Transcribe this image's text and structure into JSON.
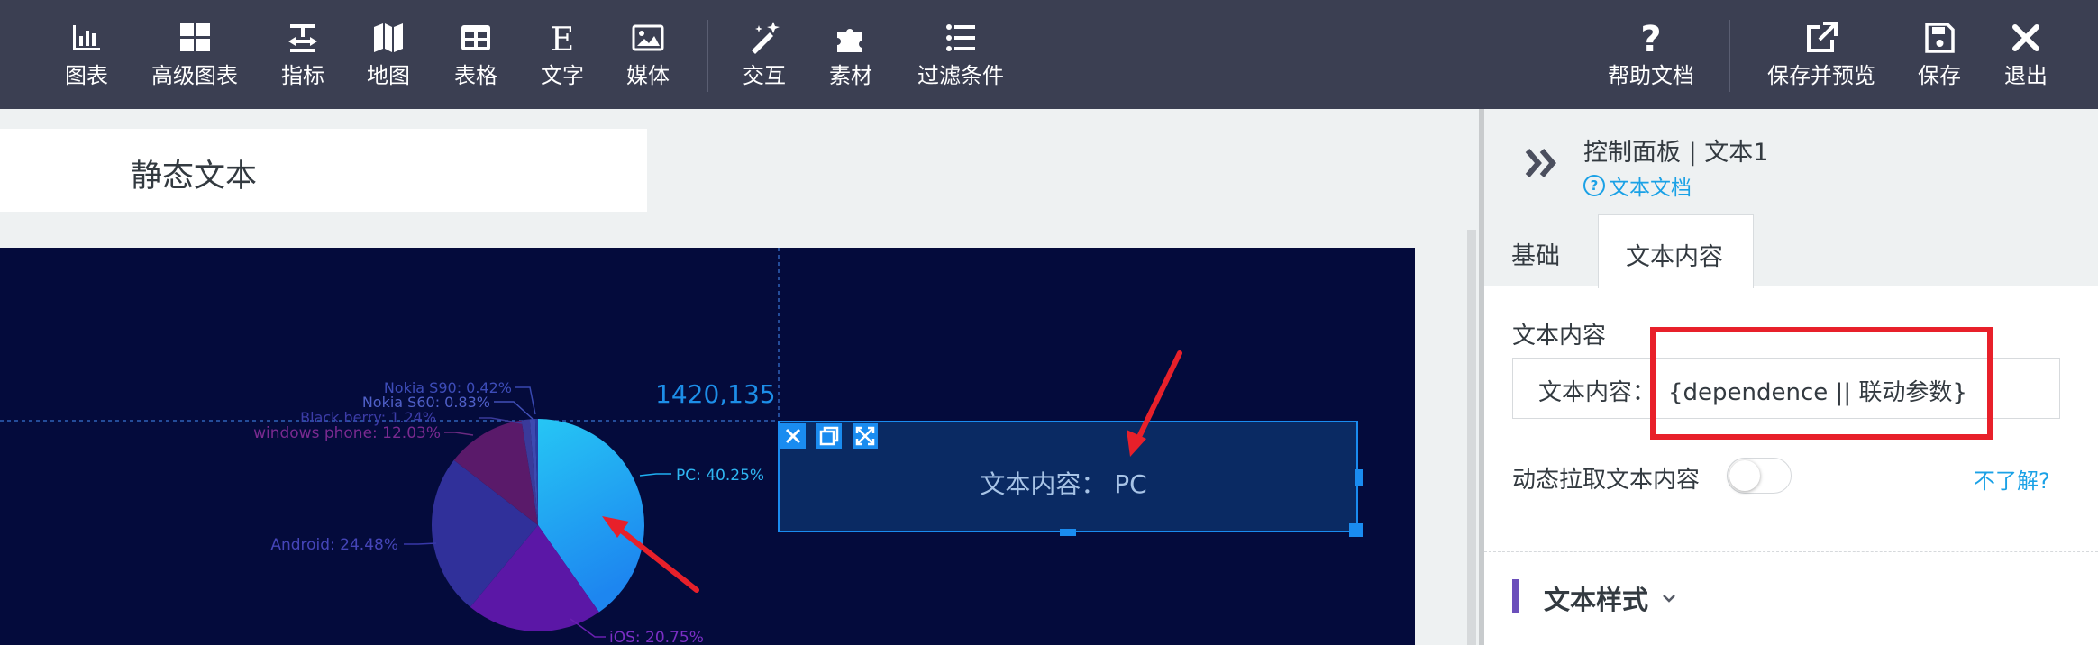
{
  "toolbar": {
    "left_tools": [
      {
        "label": "图表",
        "icon": "bar-chart-icon"
      },
      {
        "label": "高级图表",
        "icon": "grid-icon"
      },
      {
        "label": "指标",
        "icon": "indicator-icon"
      },
      {
        "label": "地图",
        "icon": "map-icon"
      },
      {
        "label": "表格",
        "icon": "table-icon"
      },
      {
        "label": "文字",
        "icon": "text-icon"
      },
      {
        "label": "媒体",
        "icon": "image-icon"
      }
    ],
    "middle_tools": [
      {
        "label": "交互",
        "icon": "magic-wand-icon"
      },
      {
        "label": "素材",
        "icon": "puzzle-icon"
      },
      {
        "label": "过滤条件",
        "icon": "list-icon"
      }
    ],
    "right_tools": [
      {
        "label": "帮助文档",
        "icon": "question-icon"
      },
      {
        "label": "保存并预览",
        "icon": "external-link-icon"
      },
      {
        "label": "保存",
        "icon": "save-icon"
      },
      {
        "label": "退出",
        "icon": "close-icon"
      }
    ]
  },
  "canvas": {
    "title_text": "静态文本",
    "metric_value": "1420,135",
    "text_box_content": "文本内容： PC"
  },
  "chart_data": {
    "type": "pie",
    "categories": [
      "PC",
      "iOS",
      "Android",
      "windows phone",
      "Black berry",
      "Nokia S60",
      "Nokia S90"
    ],
    "values": [
      40.25,
      20.75,
      24.48,
      12.03,
      1.24,
      0.83,
      0.42
    ],
    "labels": [
      "PC: 40.25%",
      "iOS: 20.75%",
      "Android: 24.48%",
      "windows phone: 12.03%",
      "Black berry: 1.24%",
      "Nokia S60: 0.83%",
      "Nokia S90: 0.42%"
    ],
    "colors": [
      "#1eb0f2",
      "#5b17a6",
      "#30309a",
      "#5a1a6a",
      "#3a3a9a",
      "#3d4ab0",
      "#2a3aa0"
    ],
    "title": "",
    "legend": "none"
  },
  "panel": {
    "title": "控制面板 | 文本1",
    "doc_link": "文本文档",
    "tabs": [
      {
        "label": "基础",
        "active": false
      },
      {
        "label": "文本内容",
        "active": true
      }
    ],
    "section_label": "文本内容",
    "input_prefix": "文本内容：",
    "input_value": "{dependence || 联动参数}",
    "toggle_label": "动态拉取文本内容",
    "toggle_on": false,
    "help_link": "不了解?",
    "style_section": "文本样式",
    "accent_color": "#1aa1e6",
    "section_bar_color": "#6b4fbb"
  },
  "annotation_color": "#e8202a"
}
